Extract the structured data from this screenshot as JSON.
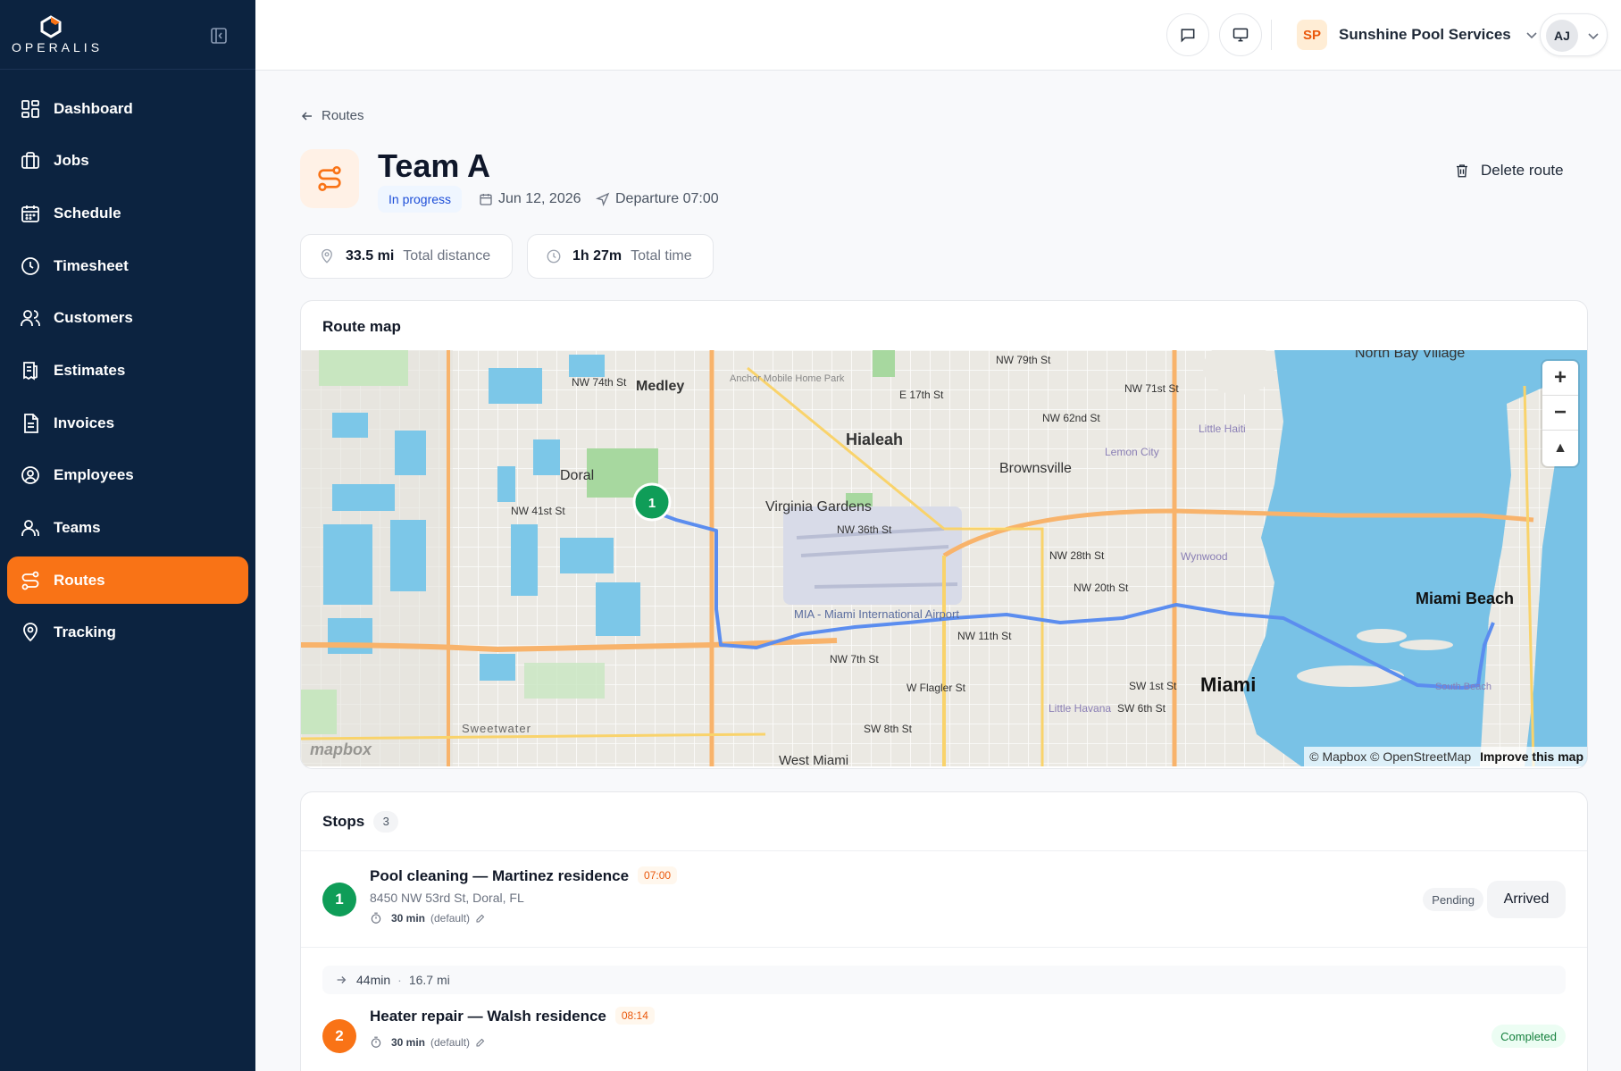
{
  "app": {
    "brand": "OPERALIS"
  },
  "sidebar": {
    "items": [
      {
        "label": "Dashboard",
        "icon": "grid-icon"
      },
      {
        "label": "Jobs",
        "icon": "briefcase-icon"
      },
      {
        "label": "Schedule",
        "icon": "calendar-icon"
      },
      {
        "label": "Timesheet",
        "icon": "clock-icon"
      },
      {
        "label": "Customers",
        "icon": "users-icon"
      },
      {
        "label": "Estimates",
        "icon": "estimate-icon"
      },
      {
        "label": "Invoices",
        "icon": "invoice-icon"
      },
      {
        "label": "Employees",
        "icon": "user-circle-icon"
      },
      {
        "label": "Teams",
        "icon": "team-icon"
      },
      {
        "label": "Routes",
        "icon": "route-icon",
        "active": true
      },
      {
        "label": "Tracking",
        "icon": "map-pin-icon"
      }
    ]
  },
  "topbar": {
    "company_initials": "SP",
    "company_name": "Sunshine Pool Services",
    "user_initials": "AJ"
  },
  "page": {
    "breadcrumb": "Routes",
    "title": "Team A",
    "status": "In progress",
    "date": "Jun 12, 2026",
    "departure": "Departure 07:00",
    "delete_label": "Delete route",
    "stats": {
      "distance_value": "33.5 mi",
      "distance_label": "Total distance",
      "time_value": "1h 27m",
      "time_label": "Total time"
    }
  },
  "map": {
    "title": "Route map",
    "attribution": "© Mapbox © OpenStreetMap",
    "improve": "Improve this map",
    "logo": "mapbox",
    "labels": [
      "Medley",
      "Hialeah",
      "Doral",
      "Brownsville",
      "Virginia Gardens",
      "Miami",
      "Miami Beach",
      "North Bay Village",
      "West Miami",
      "Sweetwater",
      "Little Haiti",
      "Lemon City",
      "Wynwood",
      "Little Havana",
      "South Beach",
      "MIA - Miami International Airport",
      "Anchor Mobile Home Park",
      "NW 74th St",
      "NW 41st St",
      "NW 36th St",
      "NW 28th St",
      "NW 20th St",
      "NW 11th St",
      "NW 7th St",
      "W Flagler St",
      "SW 8th St",
      "SW 1st St",
      "SW 6th St",
      "NW 79th St",
      "NW 71st St",
      "NW 62nd St",
      "E 17th St"
    ],
    "markers": [
      {
        "number": "1"
      }
    ]
  },
  "stops": {
    "title": "Stops",
    "count": "3",
    "items": [
      {
        "number": "1",
        "title": "Pool cleaning — Martinez residence",
        "time": "07:00",
        "address": "8450 NW 53rd St, Doral, FL",
        "duration": "30 min",
        "duration_note": "(default)",
        "status": "Pending",
        "action": "Arrived",
        "color": "#0f9d58"
      },
      {
        "number": "2",
        "title": "Heater repair — Walsh residence",
        "time": "08:14",
        "duration": "30 min",
        "duration_note": "(default)",
        "status": "Completed",
        "color": "#f97316"
      }
    ],
    "travel": {
      "time": "44min",
      "distance": "16.7 mi"
    }
  },
  "colors": {
    "sidebar": "#0c2340",
    "accent": "#f97316",
    "route": "#5b8def",
    "success": "#16a34a"
  }
}
